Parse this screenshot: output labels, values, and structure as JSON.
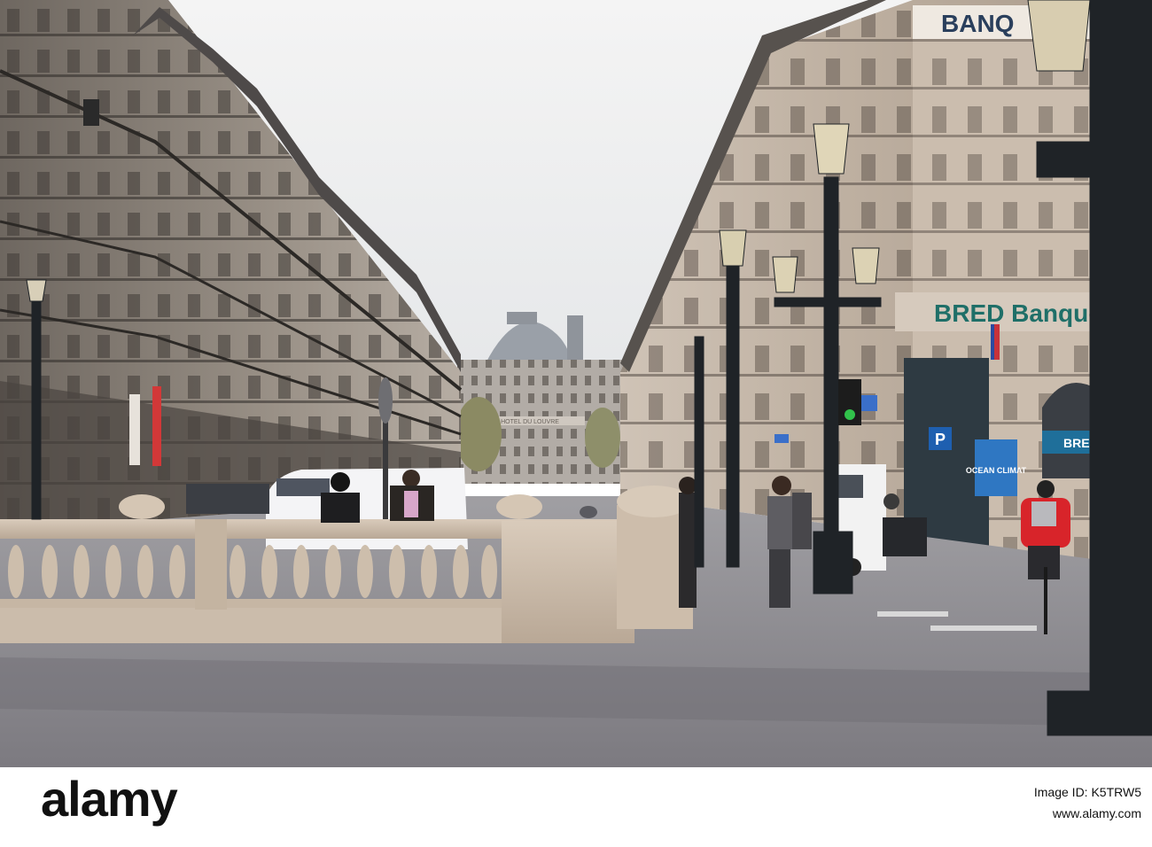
{
  "scene": {
    "description_shown": false,
    "signs": {
      "bred": "BRED Banque",
      "banq_top": "BANQ",
      "bred_window": "BRED",
      "parking": "P",
      "poster": "OCEAN CLIMAT",
      "hotel": "HOTEL DU LOUVRE"
    },
    "colors": {
      "sky": "#eef0f1",
      "stone": "#c8b8a6",
      "road": "#8e8c91",
      "bred_green": "#1f6f68",
      "cyclist_jacket": "#d8242a"
    }
  },
  "watermark": {
    "brand": "alamy",
    "image_id": "Image ID: K5TRW5",
    "url": "www.alamy.com"
  }
}
